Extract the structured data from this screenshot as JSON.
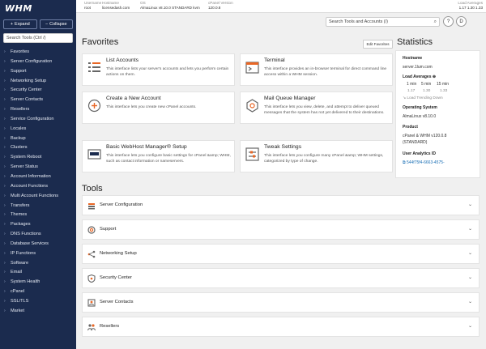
{
  "app": {
    "logo": "WHM"
  },
  "sidebar": {
    "expand_label": "Expand",
    "collapse_label": "Collapse",
    "search_placeholder": "Search Tools (Ctrl /)",
    "items": [
      "Favorites",
      "Server Configuration",
      "Support",
      "Networking Setup",
      "Security Center",
      "Server Contacts",
      "Resellers",
      "Service Configuration",
      "Locales",
      "Backup",
      "Clusters",
      "System Reboot",
      "Server Status",
      "Account Information",
      "Account Functions",
      "Multi Account Functions",
      "Transfers",
      "Themes",
      "Packages",
      "DNS Functions",
      "Database Services",
      "IP Functions",
      "Software",
      "Email",
      "System Health",
      "cPanel",
      "SSL/TLS",
      "Market"
    ]
  },
  "topbar": {
    "username_label": "Username",
    "username": "root",
    "hostname_label": "Hostname",
    "hostname": "licensedash.com",
    "os_label": "OS",
    "os": "AlmaLinux v8.10.0 STANDARD kvm",
    "cpanel_label": "cPanel Version",
    "cpanel": "120.0.8",
    "load_label": "Load Averages",
    "load": "1.17   1.30   1.33"
  },
  "search": {
    "placeholder": "Search Tools and Accounts (/)"
  },
  "user_buttons": {
    "help": "?",
    "user": "D"
  },
  "favorites": {
    "title": "Favorites",
    "edit_label": "Edit Favorites",
    "cards": [
      {
        "title": "List Accounts",
        "desc": "This interface lists your server's accounts and lets you perform certain actions on them.",
        "icon": "list-accounts-icon"
      },
      {
        "title": "Terminal",
        "desc": "This interface provides an in-browser terminal for direct command line access within a WHM session.",
        "icon": "terminal-icon"
      },
      {
        "title": "Create a New Account",
        "desc": "This interface lets you create new cPanel accounts.",
        "icon": "create-account-icon"
      },
      {
        "title": "Mail Queue Manager",
        "desc": "This interface lets you view, delete, and attempt to deliver queued messages that the system has not yet delivered to their destinations.",
        "icon": "mail-queue-icon"
      },
      {
        "title": "Basic WebHost Manager® Setup",
        "desc": "This interface lets you configure basic settings for cPanel &amp; WHM, such as contact information or nameservers.",
        "icon": "whm-setup-icon"
      },
      {
        "title": "Tweak Settings",
        "desc": "This interface lets you configure many cPanel &amp; WHM settings, categorized by type of change.",
        "icon": "tweak-settings-icon"
      }
    ]
  },
  "statistics": {
    "title": "Statistics",
    "hostname_label": "Hostname",
    "hostname": "server.1lum.com",
    "load_label": "Load Averages ⊕",
    "load_headers": [
      "1 min",
      "5 min",
      "15 min"
    ],
    "load_values": [
      "1.17",
      "1.30",
      "1.33"
    ],
    "load_trend": "↘ Load Trending Down",
    "os_label": "Operating System",
    "os": "AlmaLinux v8.10.0",
    "product_label": "Product",
    "product_line1": "cPanel & WHM v120.0.8",
    "product_line2": "(STANDARD)",
    "analytics_label": "User Analytics ID",
    "analytics_id": "544f75f4-6663-4575-"
  },
  "tools": {
    "title": "Tools",
    "sections": [
      {
        "label": "Server Configuration",
        "icon": "server-config-icon"
      },
      {
        "label": "Support",
        "icon": "support-icon"
      },
      {
        "label": "Networking Setup",
        "icon": "networking-icon"
      },
      {
        "label": "Security Center",
        "icon": "security-icon"
      },
      {
        "label": "Server Contacts",
        "icon": "contacts-icon"
      },
      {
        "label": "Resellers",
        "icon": "resellers-icon"
      }
    ]
  },
  "colors": {
    "sidebar_bg": "#1b2b4e",
    "accent": "#e86726",
    "link": "#1a6fb5"
  }
}
